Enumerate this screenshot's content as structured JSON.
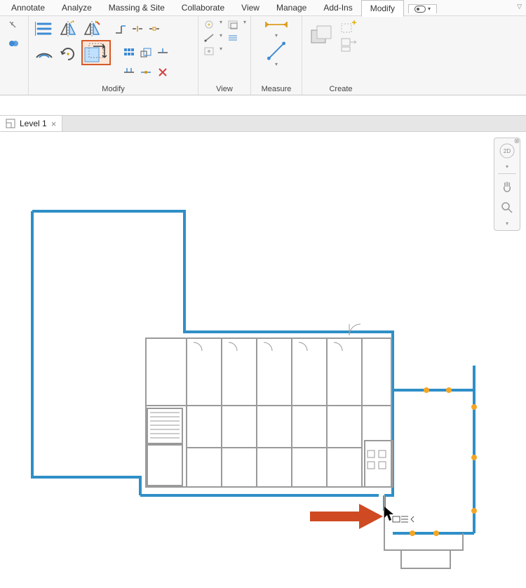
{
  "tabs": {
    "annotate": "Annotate",
    "analyze": "Analyze",
    "massing": "Massing & Site",
    "collaborate": "Collaborate",
    "view": "View",
    "manage": "Manage",
    "addins": "Add-Ins",
    "modify": "Modify"
  },
  "ctx_marker": "⏻",
  "panels": {
    "modify": "Modify",
    "view": "View",
    "measure": "Measure",
    "create": "Create"
  },
  "doc": {
    "level1": "Level 1"
  },
  "viewcube": {
    "face": "2D"
  }
}
